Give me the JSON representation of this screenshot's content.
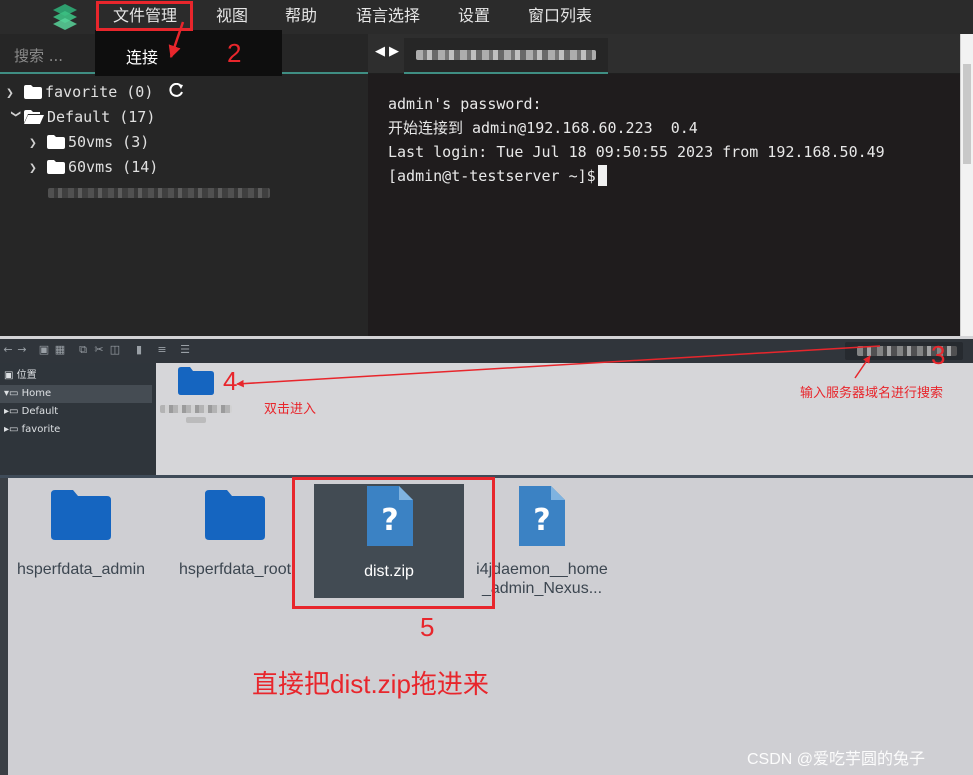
{
  "menubar": {
    "items": [
      {
        "label": "文件管理"
      },
      {
        "label": "视图"
      },
      {
        "label": "帮助"
      },
      {
        "label": "语言选择"
      },
      {
        "label": "设置"
      },
      {
        "label": "窗口列表"
      }
    ],
    "dropdown": {
      "connect_label": "连接"
    }
  },
  "sidebar": {
    "search_placeholder": "搜索 ...",
    "tree": [
      {
        "label": "favorite (0)"
      },
      {
        "label": "Default (17)"
      },
      {
        "label": "50vms (3)"
      },
      {
        "label": "60vms (14)"
      }
    ]
  },
  "terminal": {
    "lines": [
      "admin's password:",
      "开始连接到 admin@192.168.60.223  0.4",
      "Last login: Tue Jul 18 09:50:55 2023 from 192.168.50.49",
      "[admin@t-testserver ~]$"
    ]
  },
  "file_manager_top": {
    "sidebar": [
      {
        "label": "位置"
      },
      {
        "label": "Home"
      },
      {
        "label": "Default"
      },
      {
        "label": "favorite"
      }
    ]
  },
  "file_manager_bottom": {
    "files": [
      {
        "label": "hsperfdata_admin",
        "icon": "folder-icon"
      },
      {
        "label": "hsperfdata_root",
        "icon": "folder-icon"
      },
      {
        "label": "dist.zip",
        "icon": "unknown-file-icon"
      },
      {
        "label_line1": "i4jdaemon__home",
        "label_line2": "_admin_Nexus...",
        "icon": "unknown-file-icon"
      }
    ]
  },
  "annotations": {
    "step2": "2",
    "step3": "3",
    "step4": "4",
    "step5": "5",
    "search_hint": "输入服务器域名进行搜索",
    "double_click_hint": "双击进入",
    "drag_hint": "直接把dist.zip拖进来"
  },
  "watermark": "CSDN @爱吃芋圆的兔子",
  "colors": {
    "annotation": "#e8262c",
    "accent": "#3f8e83",
    "folder": "#1565c0",
    "unknown_file": "#3b82c4"
  }
}
